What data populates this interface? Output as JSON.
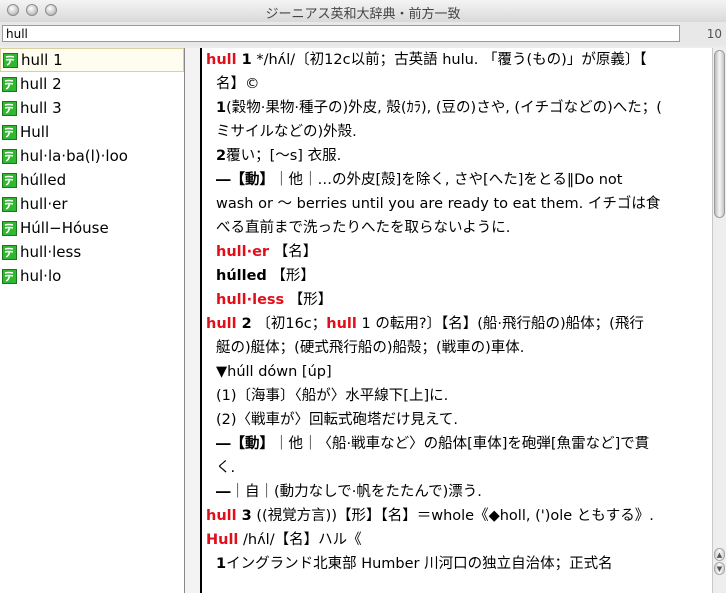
{
  "window": {
    "title": "ジーニアス英和大辞典・前方一致"
  },
  "search": {
    "value": "hull",
    "count": "10"
  },
  "sidebar": {
    "items": [
      {
        "label": "hull 1"
      },
      {
        "label": "hull 2"
      },
      {
        "label": "hull 3"
      },
      {
        "label": "Hull"
      },
      {
        "label": "hul·la·ba(l)·loo"
      },
      {
        "label": "húlled"
      },
      {
        "label": "hull·er"
      },
      {
        "label": "Húll−Hóuse"
      },
      {
        "label": "hull·less"
      },
      {
        "label": "hul·lo"
      }
    ]
  },
  "content": {
    "l1a": "hull",
    "l1b": " 1",
    "l1c": "  */hʌ́l/〔初12c以前；古英語 hulu. 「覆う(もの)」が原義〕【",
    "l2": "名】©",
    "l3a": "1",
    "l3b": "(穀物·果物·種子の)外皮, 殻(ｶﾗ), (豆の)さや, (イチゴなどの)へた；(",
    "l4": "ミサイルなどの)外殻.",
    "l5a": "2",
    "l5b": "覆い；[〜s] 衣服.",
    "l6a": "―【動】",
    "l6b": "｜他｜…の外皮[殻]を除く, さや[へた]をとる‖Do not",
    "l7": "wash or 〜 berries until you are ready to eat them. イチゴは食",
    "l8": "べる直前まで洗ったりへたを取らないように.",
    "l9a": "hull·er",
    "l9b": " 【名】",
    "l10a": "húlled",
    "l10b": " 【形】",
    "l11a": "hull·less",
    "l11b": " 【形】",
    "l12a": "hull",
    "l12b": " 2",
    "l12c": " 〔初16c；",
    "l12d": "hull",
    "l12e": " 1 の転用?〕【名】(船·飛行船の)船体；(飛行",
    "l13": "艇の)艇体；(硬式飛行船の)船殻；(戦車の)車体.",
    "l14": "▼húll dówn [úp]",
    "l15": "(1)〔海事〕〈船が〉水平線下[上]に.",
    "l16": "(2)〈戦車が〉回転式砲塔だけ見えて.",
    "l17a": "―【動】",
    "l17b": "｜他｜〈船·戦車など〉の船体[車体]を砲弾[魚雷など]で貫",
    "l18": "く.",
    "l19a": "―",
    "l19b": "｜自｜(動力なしで·帆をたたんで)漂う.",
    "l20a": "hull",
    "l20b": " 3",
    "l20c": " ((視覚方言))【形】【名】＝whole《◆holl, (')ole ともする》.",
    "l21a": "Hull",
    "l21b": " /hʌ́l/【名】ハル《",
    "l22a": "1",
    "l22b": "イングランド北東部 Humber 川河口の独立自治体；正式名"
  }
}
